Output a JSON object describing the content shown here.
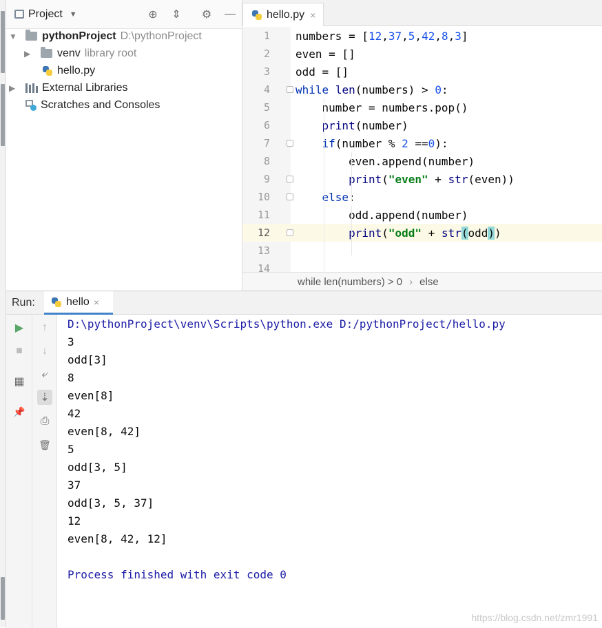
{
  "project": {
    "title": "Project",
    "tree": {
      "root_name": "pythonProject",
      "root_path": "D:\\pythonProject",
      "venv_name": "venv",
      "venv_note": "library root",
      "file": "hello.py",
      "external": "External Libraries",
      "scratches": "Scratches and Consoles"
    }
  },
  "editor": {
    "tab_label": "hello.py",
    "close_glyph": "×",
    "line_numbers": [
      "1",
      "2",
      "3",
      "4",
      "5",
      "6",
      "7",
      "8",
      "9",
      "10",
      "11",
      "12",
      "13",
      "14"
    ],
    "current_line": 12,
    "breadcrumb": [
      "while len(numbers) > 0",
      "else"
    ],
    "breadcrumb_sep": "›",
    "code_lines": [
      [
        {
          "t": "numbers = [",
          "c": ""
        },
        {
          "t": "12",
          "c": "num"
        },
        {
          "t": ",",
          "c": ""
        },
        {
          "t": "37",
          "c": "num"
        },
        {
          "t": ",",
          "c": ""
        },
        {
          "t": "5",
          "c": "num"
        },
        {
          "t": ",",
          "c": ""
        },
        {
          "t": "42",
          "c": "num"
        },
        {
          "t": ",",
          "c": ""
        },
        {
          "t": "8",
          "c": "num"
        },
        {
          "t": ",",
          "c": ""
        },
        {
          "t": "3",
          "c": "num"
        },
        {
          "t": "]",
          "c": ""
        }
      ],
      [
        {
          "t": "even = []",
          "c": ""
        }
      ],
      [
        {
          "t": "odd = []",
          "c": ""
        }
      ],
      [
        {
          "t": "while",
          "c": "kw"
        },
        {
          "t": " ",
          "c": ""
        },
        {
          "t": "len",
          "c": "bi"
        },
        {
          "t": "(numbers) > ",
          "c": ""
        },
        {
          "t": "0",
          "c": "num"
        },
        {
          "t": ":",
          "c": ""
        }
      ],
      [
        {
          "t": "    number = numbers.pop()",
          "c": ""
        }
      ],
      [
        {
          "t": "    ",
          "c": ""
        },
        {
          "t": "print",
          "c": "bi"
        },
        {
          "t": "(number)",
          "c": ""
        }
      ],
      [
        {
          "t": "    ",
          "c": ""
        },
        {
          "t": "if",
          "c": "kw"
        },
        {
          "t": "(number % ",
          "c": ""
        },
        {
          "t": "2",
          "c": "num"
        },
        {
          "t": " ==",
          "c": ""
        },
        {
          "t": "0",
          "c": "num"
        },
        {
          "t": "):",
          "c": ""
        }
      ],
      [
        {
          "t": "        even.append(number)",
          "c": ""
        }
      ],
      [
        {
          "t": "        ",
          "c": ""
        },
        {
          "t": "print",
          "c": "bi"
        },
        {
          "t": "(",
          "c": ""
        },
        {
          "t": "\"even\"",
          "c": "str"
        },
        {
          "t": " + ",
          "c": ""
        },
        {
          "t": "str",
          "c": "bi"
        },
        {
          "t": "(even))",
          "c": ""
        }
      ],
      [
        {
          "t": "    ",
          "c": ""
        },
        {
          "t": "else",
          "c": "kw"
        },
        {
          "t": ":",
          "c": ""
        }
      ],
      [
        {
          "t": "        odd.append(number)",
          "c": ""
        }
      ],
      [
        {
          "t": "        ",
          "c": ""
        },
        {
          "t": "print",
          "c": "bi"
        },
        {
          "t": "(",
          "c": ""
        },
        {
          "t": "\"odd\"",
          "c": "str"
        },
        {
          "t": " + ",
          "c": ""
        },
        {
          "t": "str",
          "c": "bi"
        },
        {
          "t": "(",
          "c": "brace-hl"
        },
        {
          "t": "odd",
          "c": ""
        },
        {
          "t": ")",
          "c": "brace-hl"
        },
        {
          "t": ")",
          "c": ""
        }
      ],
      [
        {
          "t": "",
          "c": ""
        }
      ],
      [
        {
          "t": "",
          "c": ""
        }
      ]
    ]
  },
  "run": {
    "label": "Run:",
    "tab_label": "hello",
    "close_glyph": "×",
    "output": [
      {
        "text": "D:\\pythonProject\\venv\\Scripts\\python.exe D:/pythonProject/hello.py",
        "kind": "cmd"
      },
      {
        "text": "3",
        "kind": "std"
      },
      {
        "text": "odd[3]",
        "kind": "std"
      },
      {
        "text": "8",
        "kind": "std"
      },
      {
        "text": "even[8]",
        "kind": "std"
      },
      {
        "text": "42",
        "kind": "std"
      },
      {
        "text": "even[8, 42]",
        "kind": "std"
      },
      {
        "text": "5",
        "kind": "std"
      },
      {
        "text": "odd[3, 5]",
        "kind": "std"
      },
      {
        "text": "37",
        "kind": "std"
      },
      {
        "text": "odd[3, 5, 37]",
        "kind": "std"
      },
      {
        "text": "12",
        "kind": "std"
      },
      {
        "text": "even[8, 42, 12]",
        "kind": "std"
      },
      {
        "text": "",
        "kind": "std"
      },
      {
        "text": "Process finished with exit code 0",
        "kind": "cmd"
      }
    ]
  },
  "watermark": "https://blog.csdn.net/zmr1991",
  "icons": {
    "target": "⊕",
    "collapse": "⇕",
    "gear": "⚙",
    "minimize": "—",
    "run": "▶",
    "stop": "■",
    "up": "↑",
    "down": "↓",
    "wrap": "⤶",
    "scroll_end": "⇣",
    "print": "⎙",
    "trash": "🗑",
    "layout": "▦",
    "pin": "📌",
    "dropdown": "▼",
    "tree_open": "▼",
    "tree_closed": "▶"
  },
  "colors": {
    "keyword": "#0033b3",
    "number": "#1750eb",
    "string": "#067d17",
    "console_cmd": "#1a1aa6",
    "run_green": "#59a869",
    "current_line": "#fcfae6"
  }
}
